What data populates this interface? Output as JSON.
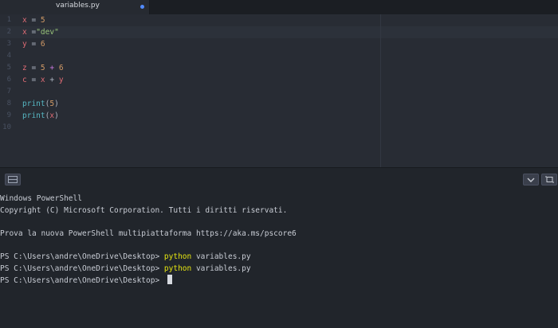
{
  "tab": {
    "filename": "variables.py"
  },
  "editor": {
    "line_numbers": [
      "1",
      "2",
      "3",
      "4",
      "5",
      "6",
      "7",
      "8",
      "9",
      "10"
    ],
    "lines": [
      {
        "a": "x",
        "b": " = ",
        "c": "5"
      },
      {
        "a": "x",
        "b": " =",
        "c": "\"dev\""
      },
      {
        "a": "y",
        "b": " = ",
        "c": "6"
      },
      {},
      {
        "a": "z",
        "b": " = ",
        "c": "5",
        "d": " + ",
        "e": "6"
      },
      {
        "a": "c",
        "b": " = ",
        "c": "x",
        "d": " + ",
        "e": "y"
      },
      {},
      {
        "a": "print",
        "b": "(",
        "c": "5",
        "d": ")"
      },
      {
        "a": "print",
        "b": "(",
        "c": "x",
        "d": ")"
      },
      {}
    ]
  },
  "panel": {
    "left_icon": "panel-toggle-icon",
    "chevron_icon": "chevron-down-icon",
    "maximize_icon": "maximize-icon"
  },
  "terminal": {
    "line1": "Windows PowerShell",
    "line2": "Copyright (C) Microsoft Corporation. Tutti i diritti riservati.",
    "line3": "Prova la nuova PowerShell multipiattaforma https://aka.ms/pscore6",
    "prompt": "PS C:\\Users\\andre\\OneDrive\\Desktop> ",
    "cmd": "python",
    "arg": " variables.py"
  },
  "colors": {
    "variable": "#e06c75",
    "number": "#d19a66",
    "string": "#98c379",
    "command": "#e5e510"
  }
}
